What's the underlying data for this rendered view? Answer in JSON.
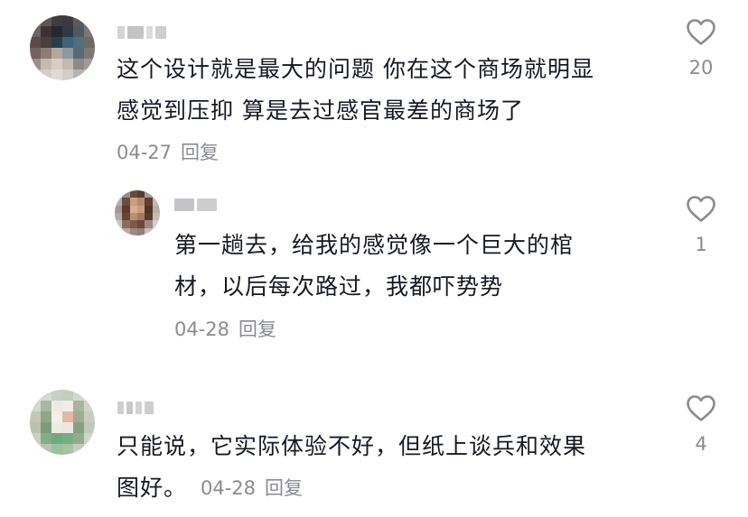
{
  "comments": [
    {
      "text_lines": [
        "这个设计就是最大的问题 你在这个商场就明显",
        "感觉到压抑 算是去过感官最差的商场了"
      ],
      "date": "04-27",
      "reply_label": "回复",
      "like_count": "20",
      "replies": [
        {
          "text_lines": [
            "第一趟去，给我的感觉像一个巨大的棺",
            "材，以后每次路过，我都吓势势"
          ],
          "date": "04-28",
          "reply_label": "回复",
          "like_count": "1"
        }
      ]
    },
    {
      "text_lines": [
        "只能说，它实际体验不好，但纸上谈兵和效果",
        "图好。"
      ],
      "date": "04-28",
      "reply_label": "回复",
      "like_count": "4",
      "replies": []
    }
  ],
  "icons": {
    "like": "heart-outline-icon"
  },
  "colors": {
    "text": "#161823",
    "meta": "#8a8b91",
    "icon": "#8a8b91"
  }
}
